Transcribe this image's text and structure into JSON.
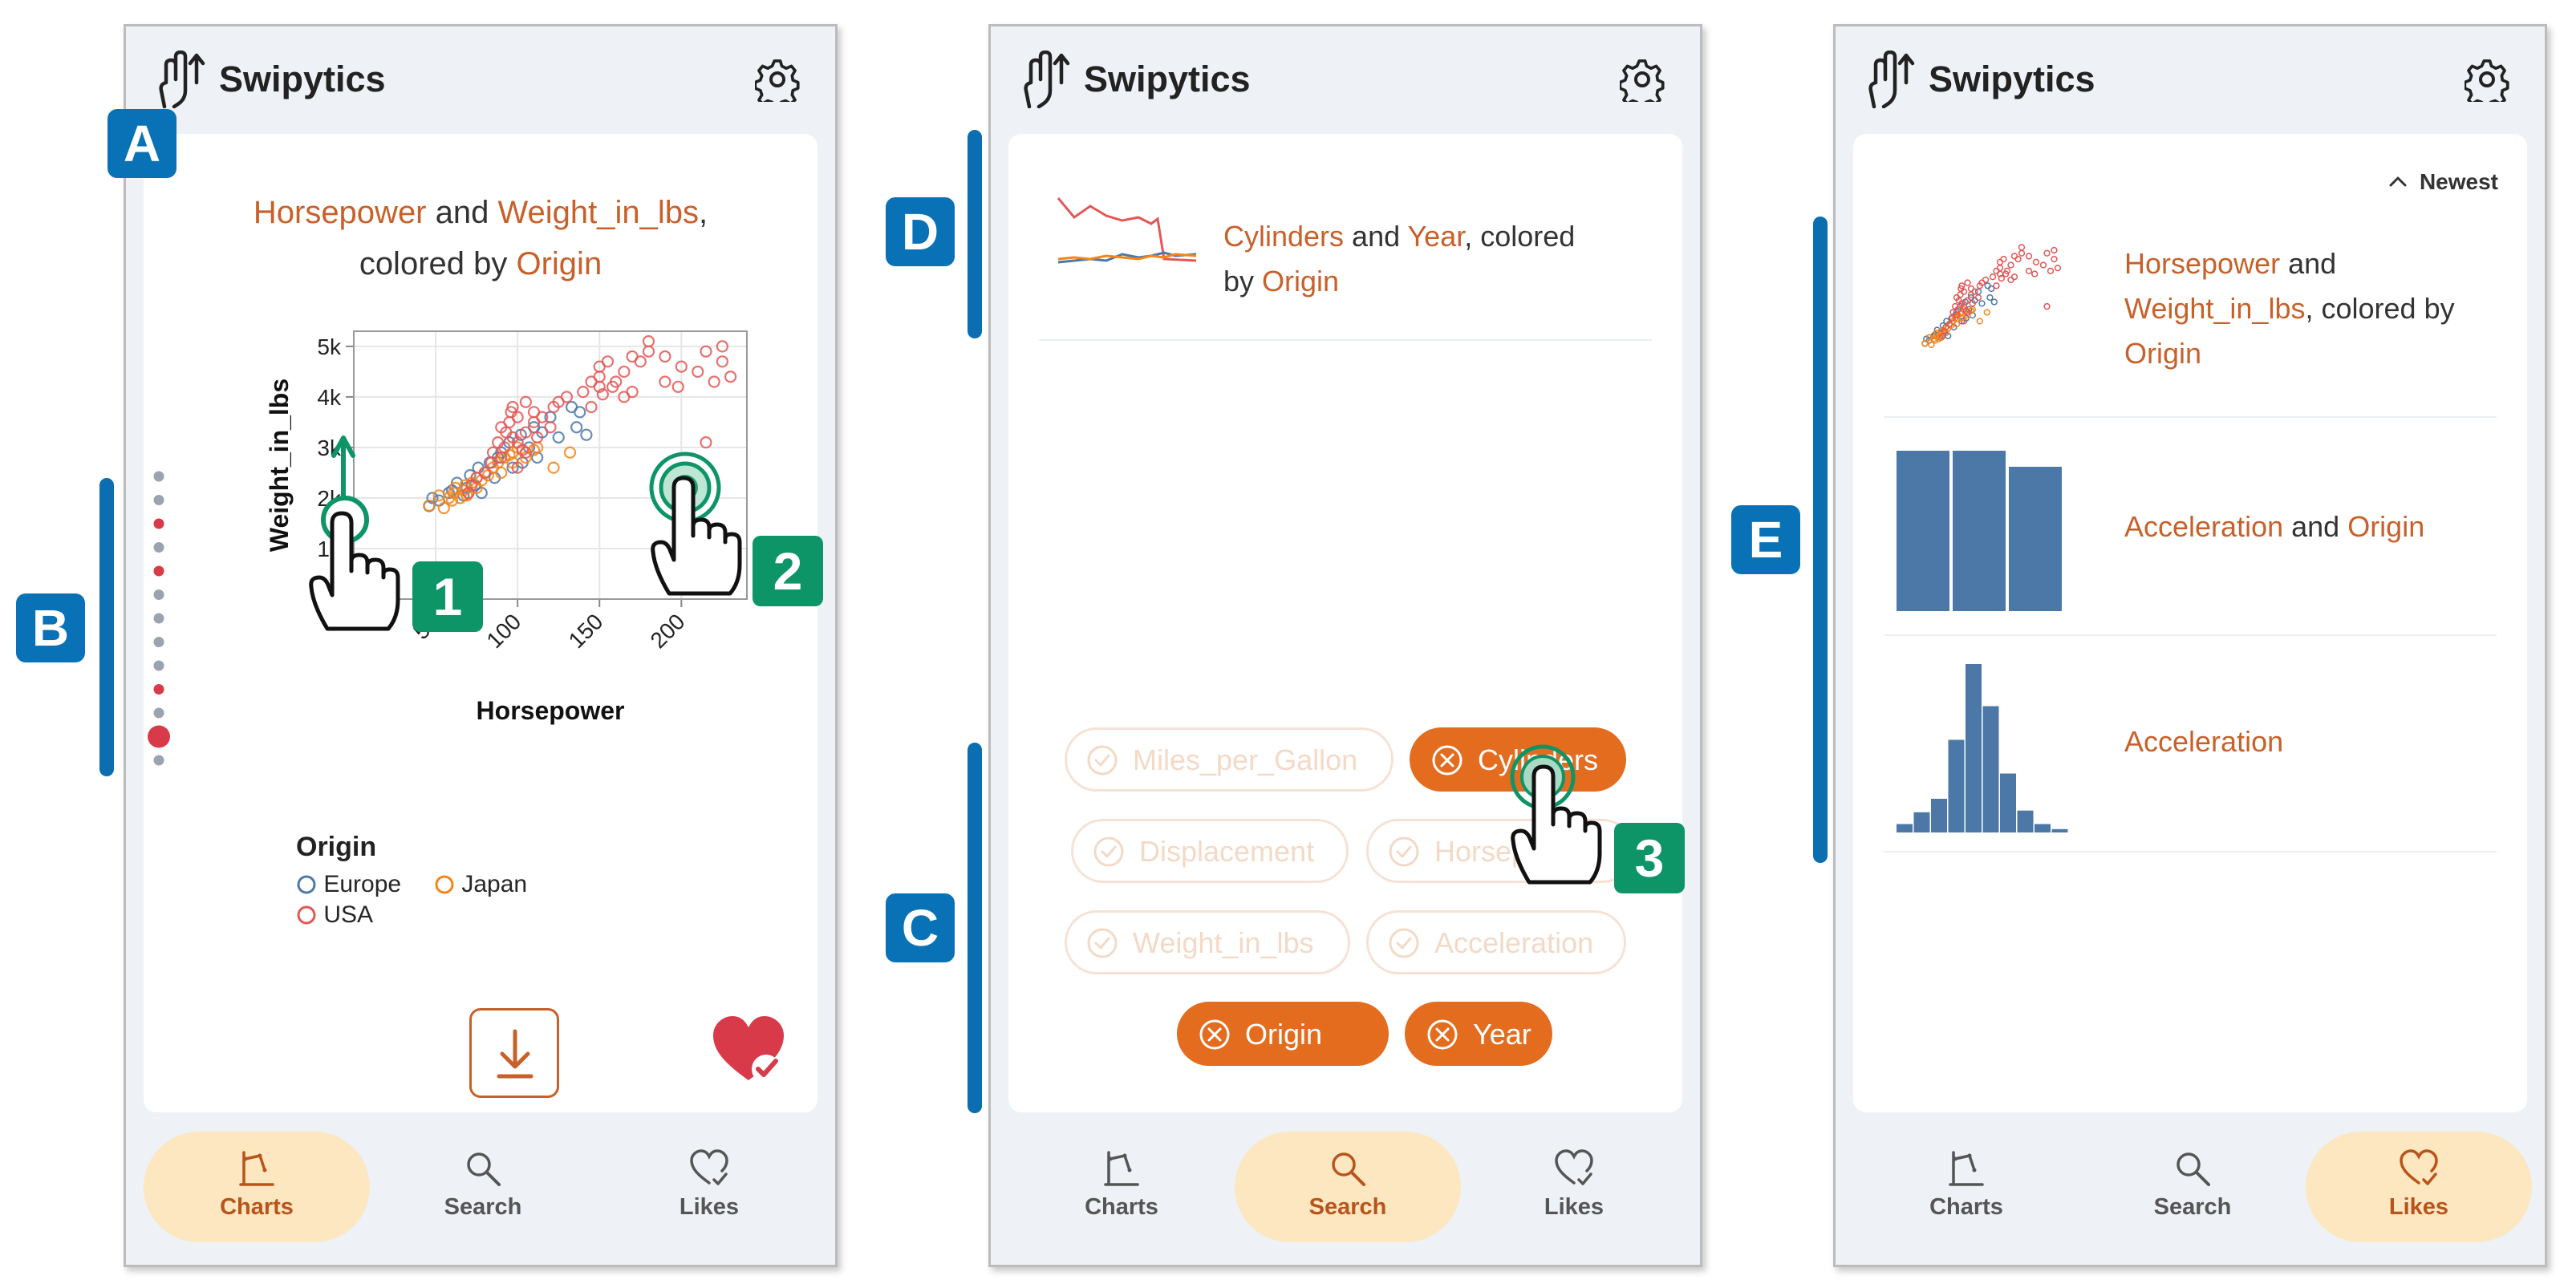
{
  "app": {
    "name": "Swipytics",
    "logo_icon": "swipe-hand-icon",
    "settings_icon": "gear-icon"
  },
  "nav": {
    "charts": "Charts",
    "search": "Search",
    "likes": "Likes"
  },
  "colors": {
    "accent": "#c8602a",
    "accent_fill": "#e36c1f",
    "active_tab": "#fce7c1",
    "marker": "#0972b6",
    "gesture": "#0d9467",
    "europe": "#4c78a8",
    "japan": "#f58518",
    "usa": "#e45756"
  },
  "panel_a": {
    "marker": "A",
    "title": {
      "f1": "Horsepower",
      "and": " and ",
      "f2": "Weight_in_lbs",
      "comma": ",",
      "colored_by": "colored by ",
      "f3": "Origin"
    },
    "chart_data": {
      "type": "scatter",
      "xlabel": "Horsepower",
      "ylabel": "Weight_in_lbs",
      "xlim": [
        0,
        240
      ],
      "ylim": [
        0,
        5300
      ],
      "x_ticks": [
        "0",
        "50",
        "100",
        "150",
        "200"
      ],
      "y_ticks": [
        "0",
        "1k",
        "2k",
        "3k",
        "4k",
        "5k"
      ],
      "grid": true,
      "legend_title": "Origin",
      "legend_position": "bottom-left",
      "series": [
        {
          "name": "Europe",
          "color": "#4c78a8"
        },
        {
          "name": "Japan",
          "color": "#f58518"
        },
        {
          "name": "USA",
          "color": "#e45756"
        }
      ],
      "points": [
        {
          "s": 0,
          "x": [
            46,
            48,
            52,
            58,
            60,
            63,
            67,
            69,
            71,
            74,
            76,
            78,
            80,
            83,
            86,
            88,
            90,
            95,
            97,
            102,
            103,
            107,
            110,
            112,
            115,
            120,
            125,
            133,
            136,
            138,
            142
          ],
          "y": [
            1840,
            2000,
            1950,
            2100,
            2150,
            2300,
            2050,
            2200,
            2450,
            2250,
            2600,
            2100,
            2500,
            2700,
            2400,
            2800,
            2900,
            3100,
            2600,
            3250,
            2700,
            3000,
            3400,
            2800,
            3300,
            3600,
            3200,
            3800,
            3400,
            3700,
            3250
          ]
        },
        {
          "s": 1,
          "x": [
            46,
            52,
            55,
            58,
            60,
            61,
            62,
            65,
            67,
            68,
            69,
            70,
            72,
            75,
            75,
            78,
            80,
            82,
            85,
            88,
            90,
            92,
            95,
            97,
            97,
            100,
            105,
            110,
            112,
            122,
            132
          ],
          "y": [
            1850,
            2050,
            1800,
            2000,
            1950,
            2100,
            2200,
            2000,
            2150,
            2250,
            2050,
            2100,
            2300,
            2200,
            2400,
            2350,
            2500,
            2450,
            2600,
            2700,
            2500,
            2800,
            2850,
            2900,
            2700,
            3000,
            2800,
            2950,
            3000,
            2600,
            2900
          ]
        },
        {
          "s": 2,
          "x": [
            70,
            72,
            75,
            80,
            84,
            85,
            88,
            90,
            90,
            92,
            95,
            97,
            97,
            100,
            100,
            100,
            105,
            105,
            105,
            110,
            110,
            112,
            115,
            120,
            122,
            125,
            130,
            140,
            145,
            145,
            150,
            150,
            150,
            152,
            155,
            158,
            160,
            165,
            165,
            170,
            170,
            175,
            180,
            180,
            190,
            190,
            198,
            200,
            210,
            215,
            220,
            225,
            225,
            230,
            215,
            93,
            96,
            103
          ],
          "y": [
            2100,
            2250,
            2400,
            2500,
            2700,
            2900,
            3100,
            2800,
            3400,
            3000,
            3500,
            3200,
            3800,
            2600,
            3100,
            3600,
            3300,
            3900,
            2900,
            3500,
            3700,
            3200,
            3600,
            3400,
            3800,
            3900,
            4000,
            4100,
            4300,
            3800,
            4200,
            4400,
            4600,
            4050,
            4700,
            4200,
            4300,
            4500,
            4000,
            4800,
            4100,
            4700,
            4900,
            5100,
            4300,
            4800,
            4200,
            4600,
            4500,
            4900,
            4300,
            5000,
            4700,
            4400,
            3100,
            3300,
            3700,
            2950
          ]
        }
      ]
    },
    "gesture1": "1",
    "gesture2": "2",
    "download_icon": "download-icon",
    "like_icon": "liked-heart-icon"
  },
  "panel_b": {
    "marker": "B",
    "dot_states": [
      "seen",
      "seen",
      "liked",
      "seen",
      "liked",
      "seen",
      "seen",
      "seen",
      "seen",
      "liked",
      "seen",
      "current",
      "seen"
    ]
  },
  "panel_d": {
    "marker": "D",
    "title": {
      "f1": "Cylinders",
      "and": " and ",
      "f2": "Year",
      "colored_by": ", colored",
      "by": "by ",
      "f3": "Origin"
    }
  },
  "panel_c": {
    "marker": "C",
    "gesture3": "3",
    "pills": [
      {
        "label": "Miles_per_Gallon",
        "state": "off"
      },
      {
        "label": "Cylinders",
        "state": "on"
      },
      {
        "label": "Displacement",
        "state": "off"
      },
      {
        "label": "Horsepower",
        "state": "off"
      },
      {
        "label": "Weight_in_lbs",
        "state": "off"
      },
      {
        "label": "Acceleration",
        "state": "off"
      },
      {
        "label": "Origin",
        "state": "on"
      },
      {
        "label": "Year",
        "state": "on"
      }
    ]
  },
  "panel_e": {
    "marker": "E",
    "sort_label": "Newest",
    "sort_icon": "chevron-up-icon",
    "items": [
      {
        "f1": "Horsepower",
        "and": " and",
        "f2": "Weight_in_lbs",
        "colored_by": ", colored by",
        "f3": "Origin"
      },
      {
        "f1": "Acceleration",
        "and": " and ",
        "f2": "Origin"
      },
      {
        "f1": "Acceleration"
      }
    ],
    "bar_values": [
      1,
      1,
      0.9
    ],
    "histogram_values": [
      0.05,
      0.12,
      0.2,
      0.55,
      1,
      0.75,
      0.35,
      0.13,
      0.05,
      0.02
    ]
  }
}
